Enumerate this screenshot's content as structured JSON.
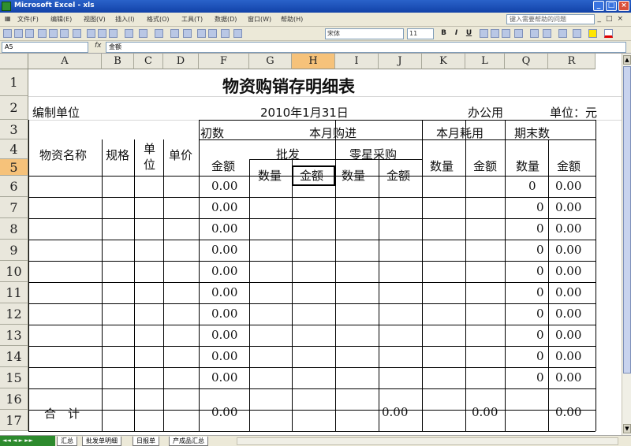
{
  "window": {
    "title": "Microsoft Excel - xls"
  },
  "menu": {
    "items": [
      "文件(F)",
      "编辑(E)",
      "视图(V)",
      "插入(I)",
      "格式(O)",
      "工具(T)",
      "数据(D)",
      "窗口(W)",
      "帮助(H)"
    ],
    "help_placeholder": "键入需要帮助的问题"
  },
  "toolbar": {
    "font_name": "宋体",
    "font_size": "11",
    "bold": "B",
    "italic": "I",
    "underline": "U"
  },
  "formula_bar": {
    "name_box": "A5",
    "fx": "fx",
    "content": "金额"
  },
  "columns": {
    "headers": [
      "A",
      "B",
      "C",
      "D",
      "F",
      "G",
      "H",
      "I",
      "J",
      "K",
      "L",
      "Q",
      "R"
    ],
    "active": "H"
  },
  "rows": {
    "headers": [
      "1",
      "2",
      "3",
      "4",
      "5",
      "6",
      "7",
      "8",
      "9",
      "10",
      "11",
      "12",
      "13",
      "14",
      "15",
      "16",
      "17"
    ],
    "active": "5"
  },
  "sheet": {
    "title": "物资购销存明细表",
    "unit_label": "编制单位",
    "date": "2010年1月31日",
    "dept": "办公用",
    "unit_suffix": "单位：元",
    "opening": "初数",
    "purchase": "本月购进",
    "usage": "本月耗用",
    "closing": "期末数",
    "col_name": "物资名称",
    "col_spec": "规格",
    "col_unit_a": "单",
    "col_unit_b": "位",
    "col_price": "单价",
    "col_amount": "金额",
    "wholesale": "批发",
    "retail": "零星采购",
    "qty": "数量",
    "amt": "金额",
    "qty_g": "数量",
    "amt_h": "金额",
    "qty_i": "数量",
    "amt_j": "金额",
    "qty_k": "数量",
    "amt_l": "金额",
    "qty_q": "数量",
    "amt_r": "金额",
    "total_label": "合　计",
    "zero": "0.00",
    "q6": "0",
    "q_zero": "0"
  },
  "tabs": {
    "nav": "◄◄ ◄ ► ►►",
    "sheets": [
      "汇总",
      "批发单明细",
      "日报单",
      "产成品汇总"
    ]
  }
}
